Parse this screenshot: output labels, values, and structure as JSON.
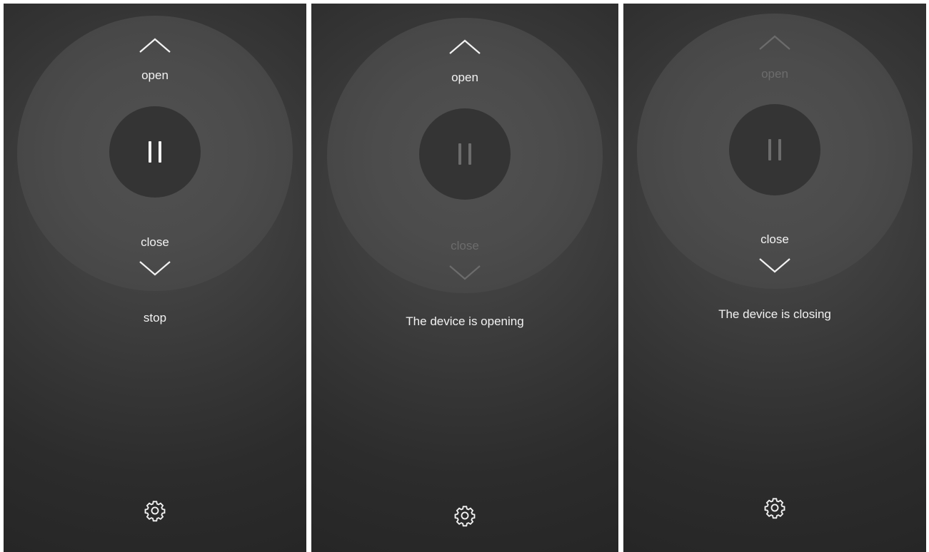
{
  "screens": [
    {
      "open_label": "open",
      "close_label": "close",
      "status_text": "stop",
      "state": "stopped",
      "open_enabled": true,
      "close_enabled": true,
      "pause_enabled": true
    },
    {
      "open_label": "open",
      "close_label": "close",
      "status_text": "The device is opening",
      "state": "opening",
      "open_enabled": true,
      "close_enabled": false,
      "pause_enabled": false
    },
    {
      "open_label": "open",
      "close_label": "close",
      "status_text": "The device is closing",
      "state": "closing",
      "open_enabled": false,
      "close_enabled": true,
      "pause_enabled": false
    }
  ],
  "icons": {
    "open": "chevron-up-icon",
    "close": "chevron-down-icon",
    "pause": "pause-icon",
    "settings": "gear-icon"
  },
  "colors": {
    "active": "#f2f2f2",
    "disabled": "#6c6c6c",
    "background": "#2a2a2a"
  }
}
